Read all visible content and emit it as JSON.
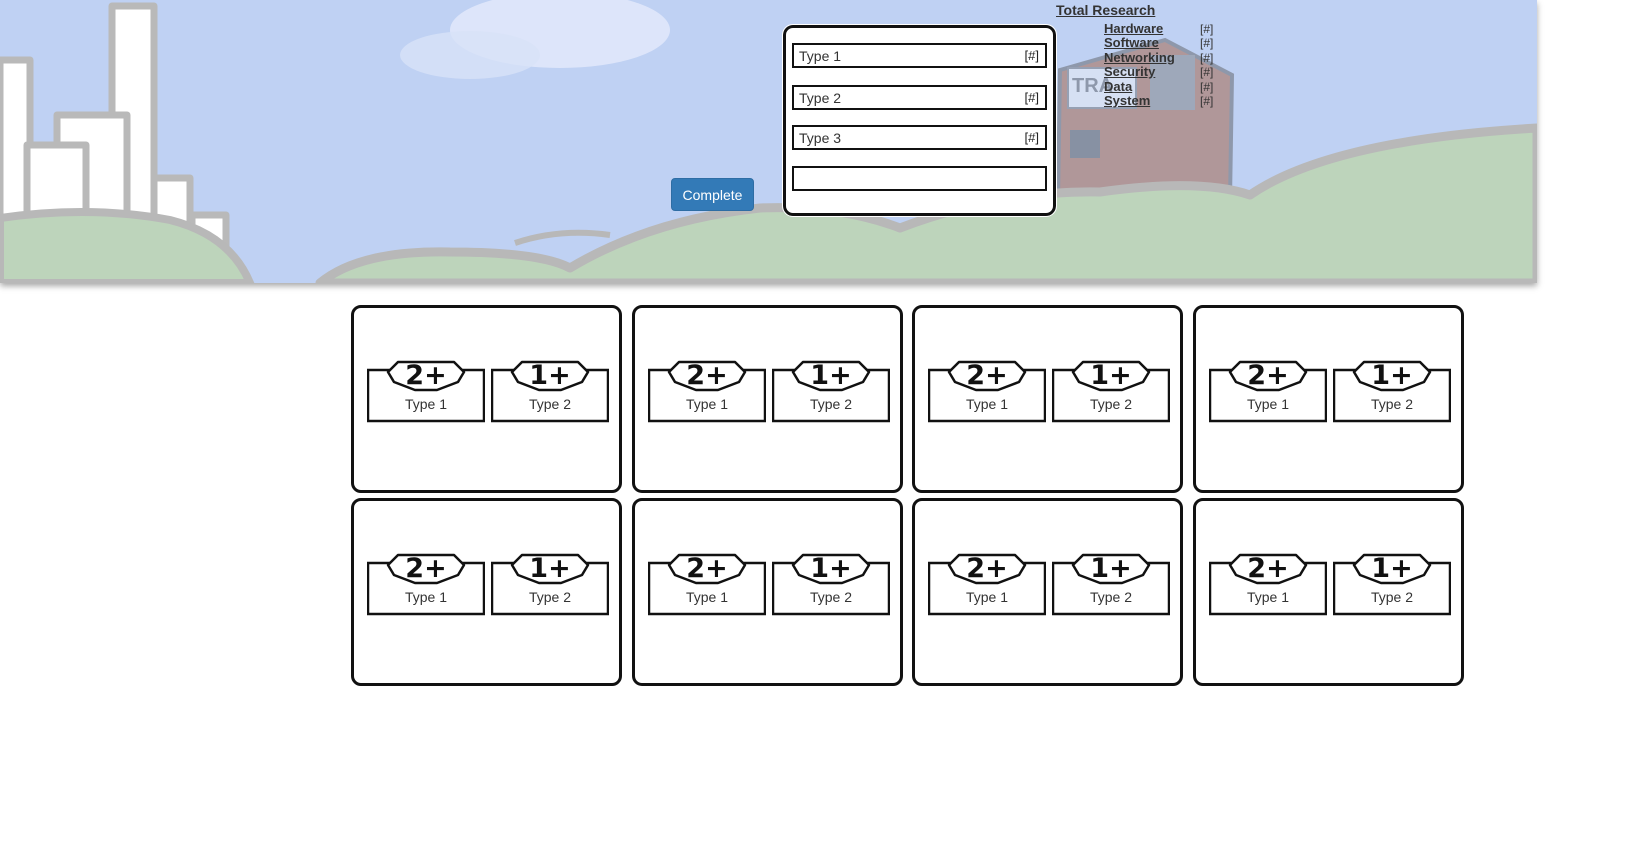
{
  "controls": {
    "complete_label": "Complete"
  },
  "type_panel": {
    "rows": [
      {
        "label": "Type 1",
        "count": "[#]"
      },
      {
        "label": "Type 2",
        "count": "[#]"
      },
      {
        "label": "Type 3",
        "count": "[#]"
      }
    ],
    "input_value": ""
  },
  "research": {
    "title": "Total Research",
    "items": [
      {
        "name": "Hardware",
        "value": "[#]"
      },
      {
        "name": "Software",
        "value": "[#]"
      },
      {
        "name": "Networking",
        "value": "[#]"
      },
      {
        "name": "Security",
        "value": "[#]"
      },
      {
        "name": "Data",
        "value": "[#]"
      },
      {
        "name": "System",
        "value": "[#]"
      }
    ]
  },
  "background": {
    "sign_text": "TRA"
  },
  "cards": [
    {
      "left": {
        "req": "2+",
        "label": "Type 1"
      },
      "right": {
        "req": "1+",
        "label": "Type 2"
      }
    },
    {
      "left": {
        "req": "2+",
        "label": "Type 1"
      },
      "right": {
        "req": "1+",
        "label": "Type 2"
      }
    },
    {
      "left": {
        "req": "2+",
        "label": "Type 1"
      },
      "right": {
        "req": "1+",
        "label": "Type 2"
      }
    },
    {
      "left": {
        "req": "2+",
        "label": "Type 1"
      },
      "right": {
        "req": "1+",
        "label": "Type 2"
      }
    },
    {
      "left": {
        "req": "2+",
        "label": "Type 1"
      },
      "right": {
        "req": "1+",
        "label": "Type 2"
      }
    },
    {
      "left": {
        "req": "2+",
        "label": "Type 1"
      },
      "right": {
        "req": "1+",
        "label": "Type 2"
      }
    },
    {
      "left": {
        "req": "2+",
        "label": "Type 1"
      },
      "right": {
        "req": "1+",
        "label": "Type 2"
      }
    },
    {
      "left": {
        "req": "2+",
        "label": "Type 1"
      },
      "right": {
        "req": "1+",
        "label": "Type 2"
      }
    }
  ]
}
